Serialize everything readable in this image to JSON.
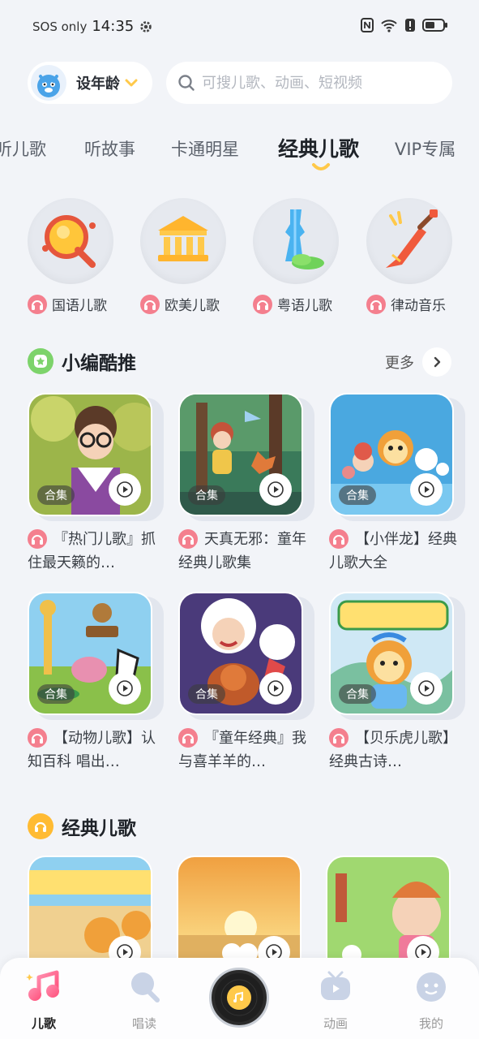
{
  "status": {
    "carrier": "SOS only",
    "time": "14:35"
  },
  "header": {
    "age_label": "设年龄",
    "search_placeholder": "可搜儿歌、动画、短视频"
  },
  "tabs": [
    "听儿歌",
    "听故事",
    "卡通明星",
    "经典儿歌",
    "VIP专属"
  ],
  "active_tab": "经典儿歌",
  "categories": [
    {
      "label": "国语儿歌",
      "icon": "drum-icon"
    },
    {
      "label": "欧美儿歌",
      "icon": "temple-icon"
    },
    {
      "label": "粤语儿歌",
      "icon": "tower-icon"
    },
    {
      "label": "律动音乐",
      "icon": "guitar-icon"
    }
  ],
  "section_recommend": {
    "title": "小编酷推",
    "more_label": "更多",
    "cards": [
      {
        "badge": "合集",
        "title": "『热门儿歌』抓住最天籁的…"
      },
      {
        "badge": "合集",
        "title": "天真无邪：童年经典儿歌集"
      },
      {
        "badge": "合集",
        "title": "【小伴龙】经典儿歌大全"
      },
      {
        "badge": "合集",
        "title": "【动物儿歌】认知百科 唱出…"
      },
      {
        "badge": "合集",
        "title": "『童年经典』我与喜羊羊的…"
      },
      {
        "badge": "合集",
        "title": "【贝乐虎儿歌】经典古诗…"
      }
    ]
  },
  "section_classic": {
    "title": "经典儿歌"
  },
  "bottom_nav": [
    {
      "label": "儿歌",
      "active": true
    },
    {
      "label": "唱读",
      "active": false
    },
    {
      "label": "",
      "active": false
    },
    {
      "label": "动画",
      "active": false
    },
    {
      "label": "我的",
      "active": false
    }
  ],
  "colors": {
    "accent_yellow": "#ffc94a",
    "headphone_pink": "#f47f8e",
    "recommend_green": "#7dd36b",
    "classic_orange": "#ffbb33"
  }
}
